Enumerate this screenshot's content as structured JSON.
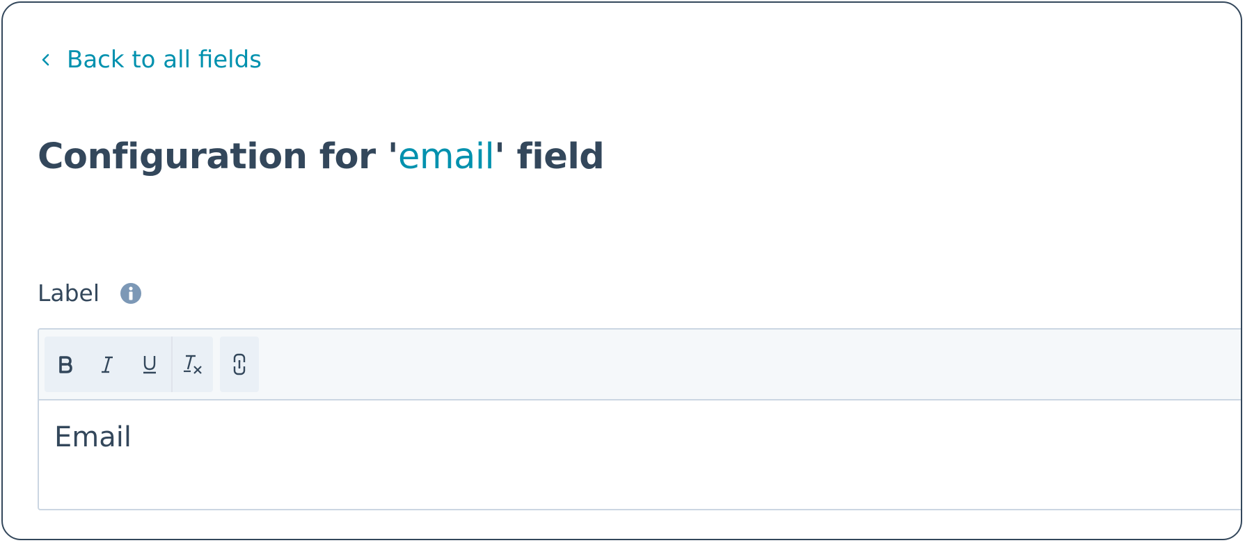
{
  "back_link": {
    "label": "Back to all fields",
    "icon": "chevron-left-icon"
  },
  "page_title": {
    "prefix": "Configuration for '",
    "field_name": "email",
    "suffix": "' field"
  },
  "label_field": {
    "label": "Label",
    "info_icon": "info-icon",
    "toolbar": {
      "buttons": [
        {
          "name": "bold",
          "icon": "bold-icon"
        },
        {
          "name": "italic",
          "icon": "italic-icon"
        },
        {
          "name": "underline",
          "icon": "underline-icon"
        },
        {
          "name": "clear-formatting",
          "icon": "clear-formatting-icon"
        },
        {
          "name": "link",
          "icon": "link-icon"
        }
      ]
    },
    "value": "Email"
  },
  "colors": {
    "text": "#33475b",
    "accent": "#0091ae",
    "border": "#cbd6e2",
    "toolbar_bg": "#f5f8fa",
    "frame_border": "#33475b"
  }
}
